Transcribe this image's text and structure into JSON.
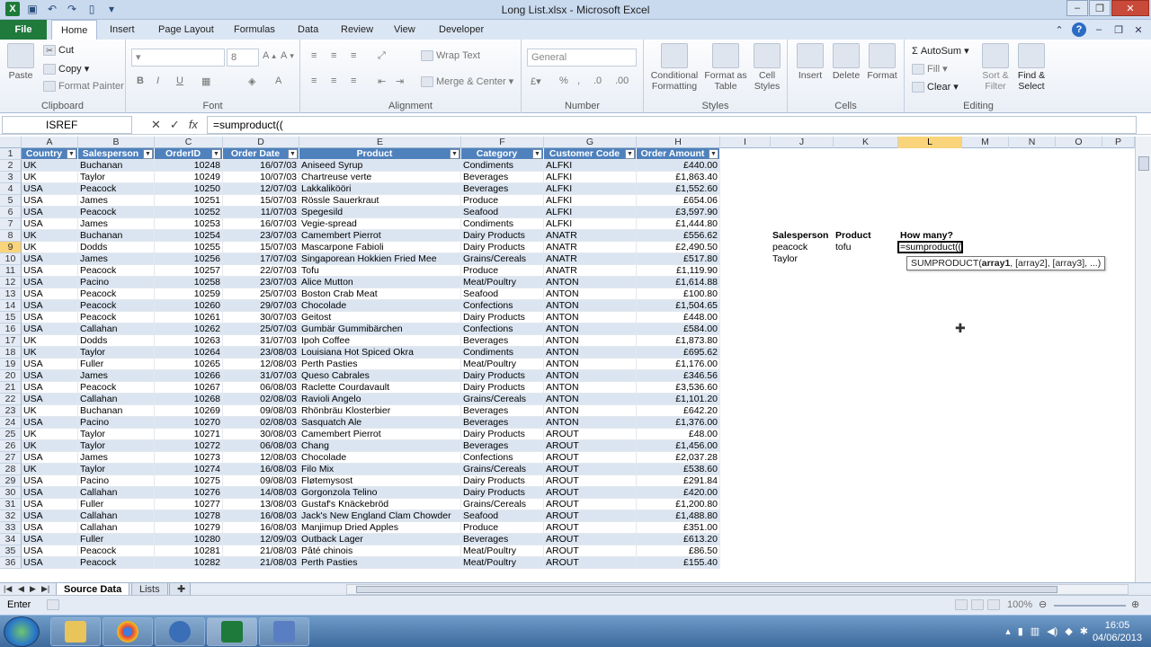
{
  "window": {
    "title": "Long List.xlsx - Microsoft Excel"
  },
  "ribbon_tabs": [
    "Home",
    "Insert",
    "Page Layout",
    "Formulas",
    "Data",
    "Review",
    "View",
    "Developer"
  ],
  "file_tab": "File",
  "clipboard": {
    "paste": "Paste",
    "cut": "Cut",
    "copy": "Copy",
    "format_painter": "Format Painter",
    "label": "Clipboard"
  },
  "font": {
    "size": "8",
    "label": "Font"
  },
  "alignment": {
    "wrap": "Wrap Text",
    "merge": "Merge & Center",
    "label": "Alignment"
  },
  "number": {
    "format": "General",
    "label": "Number"
  },
  "styles": {
    "conditional": "Conditional Formatting",
    "format_table": "Format as Table",
    "cell_styles": "Cell Styles",
    "label": "Styles"
  },
  "cells": {
    "insert": "Insert",
    "delete": "Delete",
    "format": "Format",
    "label": "Cells"
  },
  "editing": {
    "autosum": "AutoSum",
    "fill": "Fill",
    "clear": "Clear",
    "sort": "Sort & Filter",
    "find": "Find & Select",
    "label": "Editing"
  },
  "formula_bar": {
    "name_box": "ISREF",
    "formula": "=sumproduct(("
  },
  "columns": [
    "A",
    "B",
    "C",
    "D",
    "E",
    "F",
    "G",
    "H",
    "I",
    "J",
    "K",
    "L",
    "M",
    "N",
    "O",
    "P"
  ],
  "headers": [
    "Country",
    "Salesperson",
    "OrderID",
    "Order Date",
    "Product",
    "Category",
    "Customer Code",
    "Order Amount"
  ],
  "rows": [
    [
      "UK",
      "Buchanan",
      "10248",
      "16/07/03",
      "Aniseed Syrup",
      "Condiments",
      "ALFKI",
      "£440.00"
    ],
    [
      "UK",
      "Taylor",
      "10249",
      "10/07/03",
      "Chartreuse verte",
      "Beverages",
      "ALFKI",
      "£1,863.40"
    ],
    [
      "USA",
      "Peacock",
      "10250",
      "12/07/03",
      "Lakkalikööri",
      "Beverages",
      "ALFKI",
      "£1,552.60"
    ],
    [
      "USA",
      "James",
      "10251",
      "15/07/03",
      "Rössle Sauerkraut",
      "Produce",
      "ALFKI",
      "£654.06"
    ],
    [
      "USA",
      "Peacock",
      "10252",
      "11/07/03",
      "Spegesild",
      "Seafood",
      "ALFKI",
      "£3,597.90"
    ],
    [
      "USA",
      "James",
      "10253",
      "16/07/03",
      "Vegie-spread",
      "Condiments",
      "ALFKI",
      "£1,444.80"
    ],
    [
      "UK",
      "Buchanan",
      "10254",
      "23/07/03",
      "Camembert Pierrot",
      "Dairy Products",
      "ANATR",
      "£556.62"
    ],
    [
      "UK",
      "Dodds",
      "10255",
      "15/07/03",
      "Mascarpone Fabioli",
      "Dairy Products",
      "ANATR",
      "£2,490.50"
    ],
    [
      "USA",
      "James",
      "10256",
      "17/07/03",
      "Singaporean Hokkien Fried Mee",
      "Grains/Cereals",
      "ANATR",
      "£517.80"
    ],
    [
      "USA",
      "Peacock",
      "10257",
      "22/07/03",
      "Tofu",
      "Produce",
      "ANATR",
      "£1,119.90"
    ],
    [
      "USA",
      "Pacino",
      "10258",
      "23/07/03",
      "Alice Mutton",
      "Meat/Poultry",
      "ANTON",
      "£1,614.88"
    ],
    [
      "USA",
      "Peacock",
      "10259",
      "25/07/03",
      "Boston Crab Meat",
      "Seafood",
      "ANTON",
      "£100.80"
    ],
    [
      "USA",
      "Peacock",
      "10260",
      "29/07/03",
      "Chocolade",
      "Confections",
      "ANTON",
      "£1,504.65"
    ],
    [
      "USA",
      "Peacock",
      "10261",
      "30/07/03",
      "Geitost",
      "Dairy Products",
      "ANTON",
      "£448.00"
    ],
    [
      "USA",
      "Callahan",
      "10262",
      "25/07/03",
      "Gumbär Gummibärchen",
      "Confections",
      "ANTON",
      "£584.00"
    ],
    [
      "UK",
      "Dodds",
      "10263",
      "31/07/03",
      "Ipoh Coffee",
      "Beverages",
      "ANTON",
      "£1,873.80"
    ],
    [
      "UK",
      "Taylor",
      "10264",
      "23/08/03",
      "Louisiana Hot Spiced Okra",
      "Condiments",
      "ANTON",
      "£695.62"
    ],
    [
      "USA",
      "Fuller",
      "10265",
      "12/08/03",
      "Perth Pasties",
      "Meat/Poultry",
      "ANTON",
      "£1,176.00"
    ],
    [
      "USA",
      "James",
      "10266",
      "31/07/03",
      "Queso Cabrales",
      "Dairy Products",
      "ANTON",
      "£346.56"
    ],
    [
      "USA",
      "Peacock",
      "10267",
      "06/08/03",
      "Raclette Courdavault",
      "Dairy Products",
      "ANTON",
      "£3,536.60"
    ],
    [
      "USA",
      "Callahan",
      "10268",
      "02/08/03",
      "Ravioli Angelo",
      "Grains/Cereals",
      "ANTON",
      "£1,101.20"
    ],
    [
      "UK",
      "Buchanan",
      "10269",
      "09/08/03",
      "Rhönbräu Klosterbier",
      "Beverages",
      "ANTON",
      "£642.20"
    ],
    [
      "USA",
      "Pacino",
      "10270",
      "02/08/03",
      "Sasquatch Ale",
      "Beverages",
      "ANTON",
      "£1,376.00"
    ],
    [
      "UK",
      "Taylor",
      "10271",
      "30/08/03",
      "Camembert Pierrot",
      "Dairy Products",
      "AROUT",
      "£48.00"
    ],
    [
      "UK",
      "Taylor",
      "10272",
      "06/08/03",
      "Chang",
      "Beverages",
      "AROUT",
      "£1,456.00"
    ],
    [
      "USA",
      "James",
      "10273",
      "12/08/03",
      "Chocolade",
      "Confections",
      "AROUT",
      "£2,037.28"
    ],
    [
      "UK",
      "Taylor",
      "10274",
      "16/08/03",
      "Filo Mix",
      "Grains/Cereals",
      "AROUT",
      "£538.60"
    ],
    [
      "USA",
      "Pacino",
      "10275",
      "09/08/03",
      "Fløtemysost",
      "Dairy Products",
      "AROUT",
      "£291.84"
    ],
    [
      "USA",
      "Callahan",
      "10276",
      "14/08/03",
      "Gorgonzola Telino",
      "Dairy Products",
      "AROUT",
      "£420.00"
    ],
    [
      "USA",
      "Fuller",
      "10277",
      "13/08/03",
      "Gustaf's Knäckebröd",
      "Grains/Cereals",
      "AROUT",
      "£1,200.80"
    ],
    [
      "USA",
      "Callahan",
      "10278",
      "16/08/03",
      "Jack's New England Clam Chowder",
      "Seafood",
      "AROUT",
      "£1,488.80"
    ],
    [
      "USA",
      "Callahan",
      "10279",
      "16/08/03",
      "Manjimup Dried Apples",
      "Produce",
      "AROUT",
      "£351.00"
    ],
    [
      "USA",
      "Fuller",
      "10280",
      "12/09/03",
      "Outback Lager",
      "Beverages",
      "AROUT",
      "£613.20"
    ],
    [
      "USA",
      "Peacock",
      "10281",
      "21/08/03",
      "Pâté chinois",
      "Meat/Poultry",
      "AROUT",
      "£86.50"
    ],
    [
      "USA",
      "Peacock",
      "10282",
      "21/08/03",
      "Perth Pasties",
      "Meat/Poultry",
      "AROUT",
      "£155.40"
    ]
  ],
  "row_numbers": [
    "1",
    "2",
    "3",
    "4",
    "5",
    "6",
    "7",
    "8",
    "9",
    "10",
    "11",
    "12",
    "13",
    "14",
    "15",
    "16",
    "17",
    "18",
    "19",
    "20",
    "21",
    "22",
    "23",
    "24",
    "25",
    "26",
    "27",
    "28",
    "29",
    "30",
    "31",
    "32",
    "33",
    "34",
    "35",
    "36"
  ],
  "side": {
    "j8": "Salesperson",
    "k8": "Product",
    "l8": "How many?",
    "j9": "peacock",
    "k9": "tofu",
    "l9": "=sumproduct((",
    "j10": "Taylor"
  },
  "tooltip": {
    "fn": "SUMPRODUCT(",
    "arg1": "array1",
    "rest": ", [array2], [array3], ...)"
  },
  "sheets": [
    "Source Data",
    "Lists"
  ],
  "status": {
    "mode": "Enter",
    "zoom": "100%"
  },
  "clock": {
    "time": "16:05",
    "date": "04/06/2013"
  }
}
